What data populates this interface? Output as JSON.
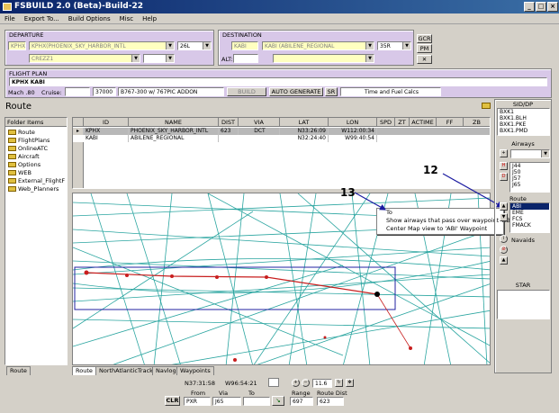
{
  "window": {
    "title": "FSBUILD 2.0 (Beta)-Build-22"
  },
  "menu": [
    "File",
    "Export To...",
    "Build Options",
    "Misc",
    "Help"
  ],
  "departure": {
    "label": "DEPARTURE",
    "icao": "KPHX",
    "airport": "KPHX(PHOENIX_SKY_HARBOR_INTL",
    "runway": "26L",
    "sid": "CREZZ1"
  },
  "destination": {
    "label": "DESTINATION",
    "icao": "KABI",
    "airport": "KABI (ABILENE_REGIONAL",
    "runway": "35R",
    "alt_label": "ALT:"
  },
  "side_buttons": {
    "gcr": "GCR",
    "pm": "PM",
    "close": "✕"
  },
  "flight_plan": {
    "label": "FLIGHT PLAN",
    "route": "KPHX KABI",
    "mach": "Mach .80",
    "cruise_label": "Cruise:",
    "cruise": "37000",
    "aircraft": "B767-300 w/ 767PIC ADDON",
    "build": "BUILD",
    "auto_generate": "AUTO GENERATE",
    "sr": "SR",
    "time_fuel": "Time and Fuel Calcs"
  },
  "route_heading": "Route",
  "folder_items": {
    "header": "Folder Items",
    "items": [
      "Route",
      "FlightPlans",
      "OnlineATC",
      "Aircraft",
      "Options",
      "WEB",
      "External_FlightF",
      "Web_Planners"
    ]
  },
  "grid": {
    "headers": [
      "ID",
      "NAME",
      "DIST",
      "VIA",
      "LAT",
      "LON",
      "SPD",
      "ZT",
      "ACTIME",
      "FF",
      "ZB"
    ],
    "rows": [
      [
        "KPHX",
        "PHOENIX_SKY_HARBOR_INTL",
        "623",
        "DCT",
        "N33:26:09",
        "W112:00:34",
        "",
        "",
        "",
        "",
        ""
      ],
      [
        "KABI",
        "ABILENE_REGIONAL",
        "",
        "",
        "N32:24:40",
        "W99:40:54",
        "",
        "",
        "",
        "",
        ""
      ]
    ]
  },
  "context_menu": {
    "items": [
      "To",
      "Show airways that pass over waypoint 'ABI'",
      "Center Map view to 'ABI' Waypoint"
    ]
  },
  "callouts": {
    "a": "13",
    "b": "12"
  },
  "sid_dp": {
    "label": "SID/DP",
    "items": [
      "BXK1",
      "BXK1.BLH",
      "BXK1.PKE",
      "BXK1.PMD"
    ]
  },
  "airways": {
    "label": "Airways",
    "items": [
      "J44",
      "J50",
      "J57",
      "J65"
    ]
  },
  "route_list": {
    "label": "Route",
    "items": [
      "ABI",
      "EME",
      "FCS",
      "FMACK"
    ]
  },
  "navaids_label": "Navaids",
  "star_label": "STAR",
  "bottom_left_tab": "Route",
  "map_tabs": [
    "Route",
    "NorthAtlanticTracks",
    "Navlog",
    "Waypoints"
  ],
  "status": {
    "lat": "N37:31:58",
    "lon": "W96:54:21",
    "zoom": "11.6",
    "clr": "CLR",
    "from_label": "From",
    "from": "PXR",
    "via_label": "Via",
    "via": "J65",
    "to_label": "To",
    "range_label": "Range",
    "range": "697",
    "route_dist_label": "Route Dist",
    "route_dist": "623"
  },
  "colors": {
    "map_bg": "#ffffff",
    "airway": "#2aa5a0",
    "route": "#c81e1e",
    "box": "#2020a0",
    "title": "#0a246a"
  }
}
